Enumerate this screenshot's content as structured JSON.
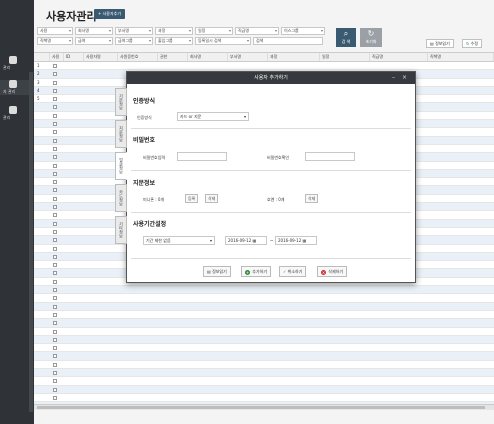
{
  "sidebar": {
    "items": [
      {
        "label": "관리",
        "icon": "user-icon"
      },
      {
        "label": "자 관리",
        "icon": "device-icon"
      },
      {
        "label": "관리",
        "icon": "person-icon"
      }
    ]
  },
  "page": {
    "title": "사용자관리",
    "add_user_label": "+ 사용자추가"
  },
  "filters": {
    "row1": [
      "사용",
      "회사명",
      "부서명",
      "과정",
      "일정",
      "직급명",
      "이스그룹"
    ],
    "row2": [
      "직책명",
      "급여",
      "급여그룹",
      "출입그룹",
      "등록일시 검색",
      "검색"
    ]
  },
  "toolbar": {
    "search_label": "검 색",
    "reset_label": "초기화",
    "info_label": "정보읽기",
    "edit_label": "수정"
  },
  "grid": {
    "columns": [
      "사용",
      "ID",
      "사용자명",
      "사원증번호",
      "권한",
      "회사명",
      "부서명",
      "과정",
      "일정",
      "직급명",
      "직책명"
    ],
    "row_numbers": [
      "1",
      "2",
      "3",
      "4",
      "5"
    ]
  },
  "modal": {
    "title": "사용자 추가하기",
    "tabs": [
      "기본정보",
      "지문정보",
      "얼굴정보",
      "카드정보",
      "기타정보"
    ],
    "auth": {
      "section": "인증방식",
      "label": "인증방식",
      "value": "카드 or 지문"
    },
    "password": {
      "section": "비밀번호",
      "input_label": "비밀번호입력",
      "confirm_label": "비밀번호확인"
    },
    "fingerprint": {
      "section": "지문정보",
      "left_label": "미니폰 : 0개",
      "right_label": "호엔 : 0개",
      "register": "등록",
      "delete": "삭제"
    },
    "period": {
      "section": "사용기간설정",
      "mode": "기간 제한 없음",
      "start": "2016-09-12",
      "end": "2016-09-12",
      "tilde": "~"
    },
    "footer": {
      "info": "정보읽기",
      "add": "추가하기",
      "cancel": "취소하기",
      "delete": "삭제하기"
    }
  }
}
